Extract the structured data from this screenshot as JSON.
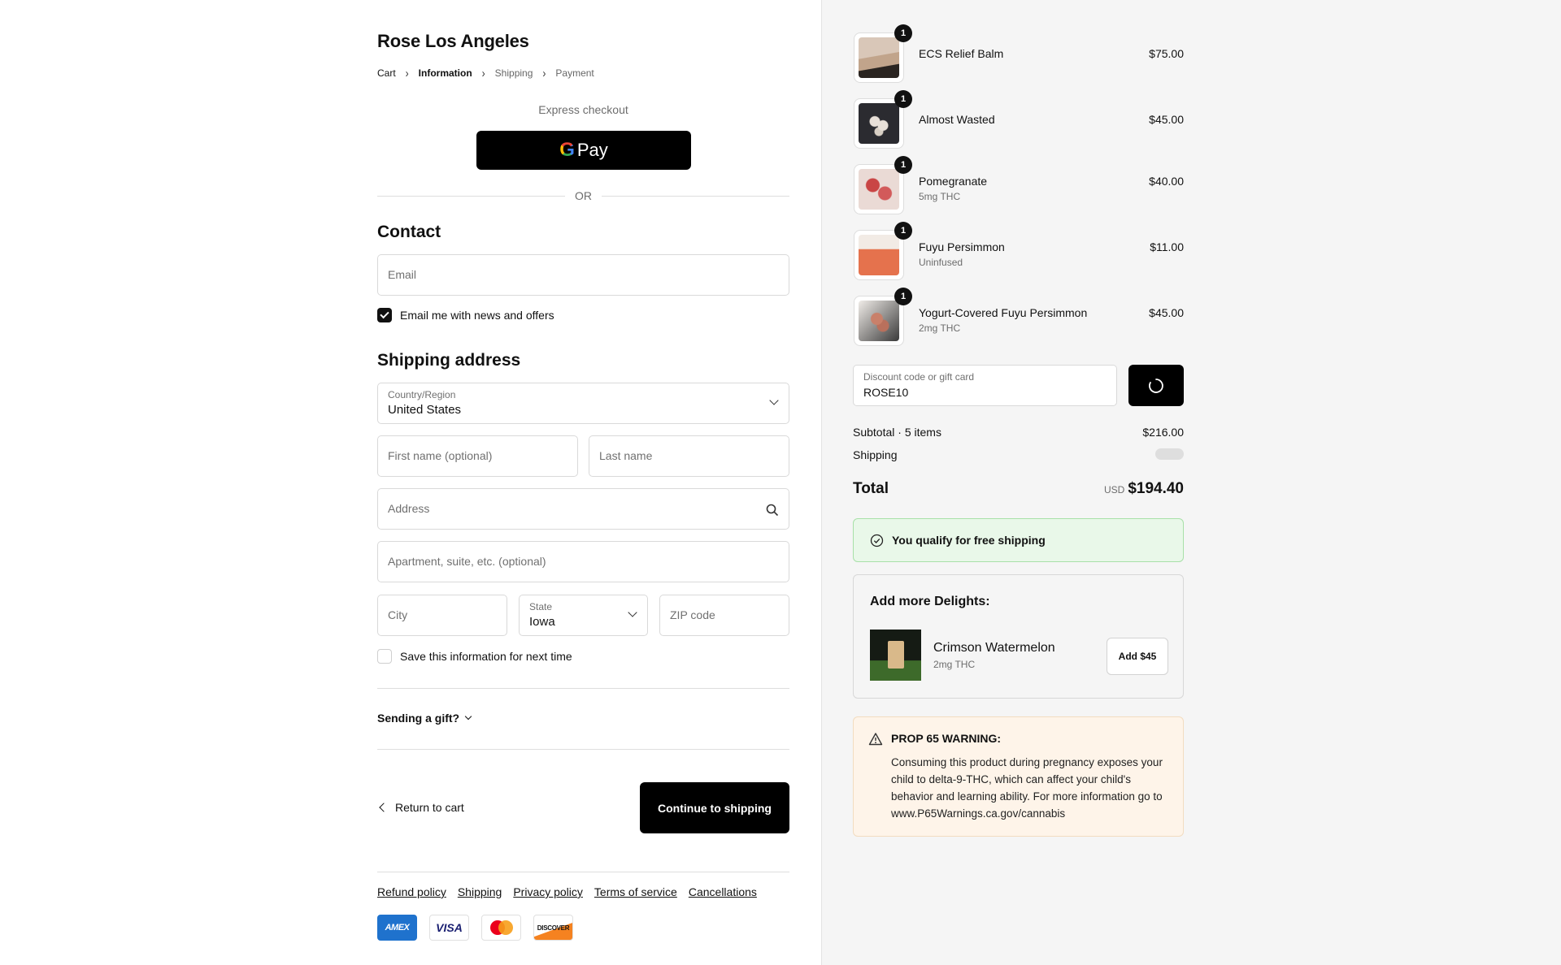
{
  "store": {
    "name": "Rose Los Angeles"
  },
  "breadcrumb": {
    "cart": "Cart",
    "information": "Information",
    "shipping": "Shipping",
    "payment": "Payment"
  },
  "express": {
    "title": "Express checkout",
    "gpay_g": "G",
    "gpay_label": "Pay",
    "or": "OR"
  },
  "contact": {
    "heading": "Contact",
    "email_placeholder": "Email",
    "news_label": "Email me with news and offers",
    "news_checked": true
  },
  "shipping_address": {
    "heading": "Shipping address",
    "country_label": "Country/Region",
    "country_value": "United States",
    "first_name_placeholder": "First name (optional)",
    "last_name_placeholder": "Last name",
    "address_placeholder": "Address",
    "apartment_placeholder": "Apartment, suite, etc. (optional)",
    "city_placeholder": "City",
    "state_label": "State",
    "state_value": "Iowa",
    "zip_placeholder": "ZIP code",
    "save_label": "Save this information for next time",
    "save_checked": false
  },
  "gift": {
    "label": "Sending a gift?"
  },
  "actions": {
    "return_label": "Return to cart",
    "continue_label": "Continue to shipping"
  },
  "footer": {
    "links": [
      "Refund policy",
      "Shipping",
      "Privacy policy",
      "Terms of service",
      "Cancellations"
    ],
    "cards": {
      "amex": "AMEX",
      "visa": "VISA",
      "discover": "DISCOVER"
    }
  },
  "order": {
    "items": [
      {
        "name": "ECS Relief Balm",
        "sub": "",
        "price": "$75.00",
        "qty": "1",
        "color": "#b59a84"
      },
      {
        "name": "Almost Wasted",
        "sub": "",
        "price": "$45.00",
        "qty": "1",
        "color": "#2f2f33"
      },
      {
        "name": "Pomegranate",
        "sub": "5mg THC",
        "price": "$40.00",
        "qty": "1",
        "color": "#c85b5b"
      },
      {
        "name": "Fuyu Persimmon",
        "sub": "Uninfused",
        "price": "$11.00",
        "qty": "1",
        "color": "#e5724d"
      },
      {
        "name": "Yogurt-Covered Fuyu Persimmon",
        "sub": "2mg THC",
        "price": "$45.00",
        "qty": "1",
        "color": "#6e5048"
      }
    ],
    "discount": {
      "label": "Discount code or gift card",
      "value": "ROSE10"
    },
    "subtotal_label": "Subtotal · 5 items",
    "subtotal_value": "$216.00",
    "shipping_label": "Shipping",
    "total_label": "Total",
    "currency": "USD",
    "total_value": "$194.40"
  },
  "free_shipping": {
    "label": "You qualify for free shipping"
  },
  "upsell": {
    "heading": "Add more Delights:",
    "product_name": "Crimson Watermelon",
    "product_sub": "2mg THC",
    "add_label": "Add $45"
  },
  "warning": {
    "title": "PROP 65 WARNING:",
    "text": "Consuming this product during pregnancy exposes your child to delta-9-THC, which can affect your child's behavior and learning ability. For more information go to www.P65Warnings.ca.gov/cannabis"
  }
}
